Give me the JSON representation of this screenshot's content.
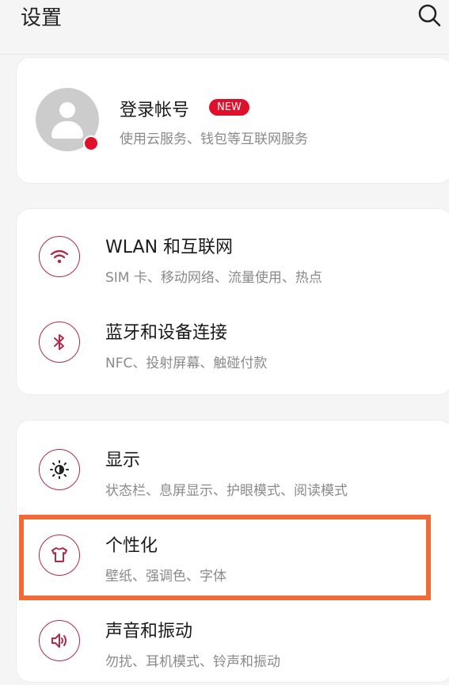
{
  "header": {
    "title": "设置",
    "search_icon": "search-icon"
  },
  "account": {
    "title": "登录帐号",
    "badge": "NEW",
    "subtitle": "使用云服务、钱包等互联网服务",
    "avatar_icon": "user-avatar-icon"
  },
  "network_group": [
    {
      "title": "WLAN 和互联网",
      "subtitle": "SIM 卡、移动网络、流量使用、热点",
      "icon": "wifi-icon"
    },
    {
      "title": "蓝牙和设备连接",
      "subtitle": "NFC、投射屏幕、触碰付款",
      "icon": "bluetooth-icon"
    }
  ],
  "display_group": [
    {
      "title": "显示",
      "subtitle": "状态栏、息屏显示、护眼模式、阅读模式",
      "icon": "brightness-icon"
    },
    {
      "title": "个性化",
      "subtitle": "壁纸、强调色、字体",
      "icon": "tshirt-icon"
    },
    {
      "title": "声音和振动",
      "subtitle": "勿扰、耳机模式、铃声和振动",
      "icon": "speaker-icon"
    }
  ],
  "colors": {
    "accent": "#b22a4a",
    "badge": "#e0102a",
    "highlight": "#f26a35"
  }
}
